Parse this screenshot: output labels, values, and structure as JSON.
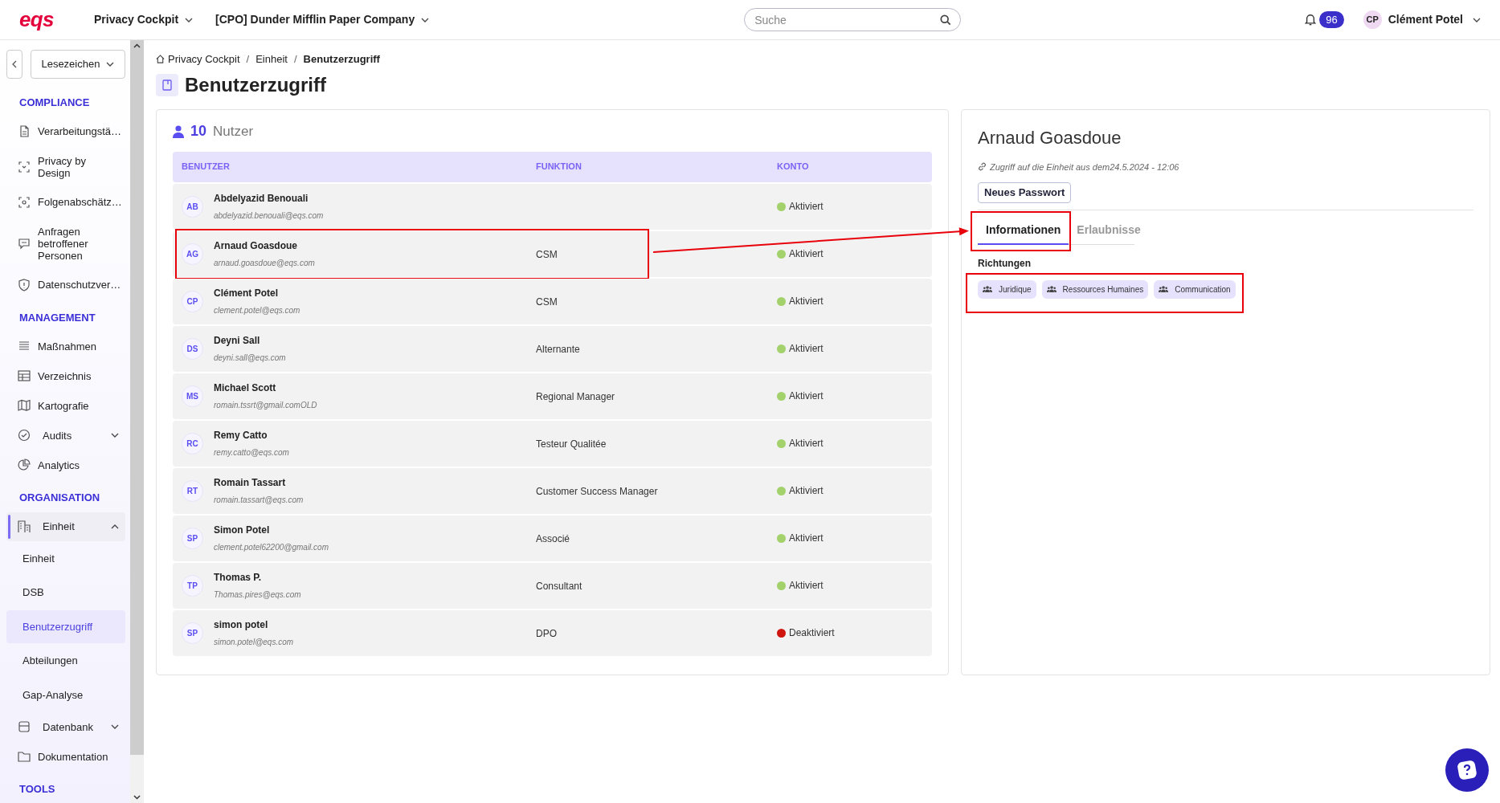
{
  "header": {
    "logo": "eqs",
    "menus": [
      "Privacy Cockpit",
      "[CPO] Dunder Mifflin Paper Company"
    ],
    "search": {
      "placeholder": "Suche"
    },
    "notifications": "96",
    "user": {
      "initials": "CP",
      "name": "Clément Potel"
    }
  },
  "sidebar": {
    "bookmarks": "Lesezeichen",
    "sections": [
      {
        "title": "COMPLIANCE",
        "items": [
          {
            "kind": "item",
            "label": "Verarbeitungstä…",
            "selected": false
          },
          {
            "kind": "item",
            "label": "Privacy by Design",
            "selected": false
          },
          {
            "kind": "item",
            "label": "Folgenabschätz…",
            "selected": false
          },
          {
            "kind": "item",
            "label": "Anfragen betroffener Personen",
            "selected": false
          },
          {
            "kind": "item",
            "label": "Datenschutzver…",
            "selected": false
          }
        ]
      },
      {
        "title": "MANAGEMENT",
        "items": [
          {
            "kind": "item",
            "label": "Maßnahmen",
            "selected": false
          },
          {
            "kind": "item",
            "label": "Verzeichnis",
            "selected": false
          },
          {
            "kind": "item",
            "label": "Kartografie",
            "selected": false
          },
          {
            "kind": "group",
            "label": "Audits",
            "expanded": false,
            "selected": false
          },
          {
            "kind": "item",
            "label": "Analytics",
            "selected": false
          }
        ]
      },
      {
        "title": "ORGANISATION",
        "items": [
          {
            "kind": "group",
            "label": "Einheit",
            "expanded": true,
            "selected": false,
            "children": [
              {
                "label": "Einheit",
                "selected": false
              },
              {
                "label": "DSB",
                "selected": false
              },
              {
                "label": "Benutzerzugriff",
                "selected": true
              },
              {
                "label": "Abteilungen",
                "selected": false
              },
              {
                "label": "Gap-Analyse",
                "selected": false
              }
            ]
          },
          {
            "kind": "group",
            "label": "Datenbank",
            "expanded": false,
            "selected": false
          },
          {
            "kind": "item",
            "label": "Dokumentation",
            "selected": false
          }
        ]
      },
      {
        "title": "TOOLS"
      }
    ]
  },
  "breadcrumb": {
    "separator": "/",
    "items": [
      "Privacy Cockpit",
      "Einheit",
      "Benutzerzugriff"
    ]
  },
  "title": "Benutzerzugriff",
  "users": {
    "count": "10",
    "count_label": "Nutzer",
    "columns": [
      "BENUTZER",
      "FUNKTION",
      "KONTO"
    ],
    "rows": [
      {
        "initials": "AB",
        "name": "Abdelyazid Benouali",
        "email": "abdelyazid.benouali@eqs.com",
        "function": "",
        "status": "Aktiviert",
        "color": "#a3d16c",
        "highlighted": false
      },
      {
        "initials": "AG",
        "name": "Arnaud Goasdoue",
        "email": "arnaud.goasdoue@eqs.com",
        "function": "CSM",
        "status": "Aktiviert",
        "color": "#a3d16c",
        "highlighted": true
      },
      {
        "initials": "CP",
        "name": "Clément Potel",
        "email": "clement.potel@eqs.com",
        "function": "CSM",
        "status": "Aktiviert",
        "color": "#a3d16c",
        "highlighted": false
      },
      {
        "initials": "DS",
        "name": "Deyni Sall",
        "email": "deyni.sall@eqs.com",
        "function": "Alternante",
        "status": "Aktiviert",
        "color": "#a3d16c",
        "highlighted": false
      },
      {
        "initials": "MS",
        "name": "Michael Scott",
        "email": "romain.tssrt@gmail.comOLD",
        "function": "Regional Manager",
        "status": "Aktiviert",
        "color": "#a3d16c",
        "highlighted": false
      },
      {
        "initials": "RC",
        "name": "Remy Catto",
        "email": "remy.catto@eqs.com",
        "function": "Testeur Qualitée",
        "status": "Aktiviert",
        "color": "#a3d16c",
        "highlighted": false
      },
      {
        "initials": "RT",
        "name": "Romain Tassart",
        "email": "romain.tassart@eqs.com",
        "function": "Customer Success Manager",
        "status": "Aktiviert",
        "color": "#a3d16c",
        "highlighted": false
      },
      {
        "initials": "SP",
        "name": "Simon Potel",
        "email": "clement.potel62200@gmail.com",
        "function": "Associé",
        "status": "Aktiviert",
        "color": "#a3d16c",
        "highlighted": false
      },
      {
        "initials": "TP",
        "name": "Thomas P.",
        "email": "Thomas.pires@eqs.com",
        "function": "Consultant",
        "status": "Aktiviert",
        "color": "#a3d16c",
        "highlighted": false
      },
      {
        "initials": "SP",
        "name": "simon potel",
        "email": "simon.potel@eqs.com",
        "function": "DPO",
        "status": "Deaktiviert",
        "color": "#d0140e",
        "highlighted": false
      }
    ]
  },
  "detail": {
    "name": "Arnaud Goasdoue",
    "access_note": "Zugriff auf die Einheit aus dem24.5.2024 - 12:06",
    "button": "Neues Passwort",
    "tabs": [
      {
        "label": "Informationen",
        "selected": true,
        "highlighted": true
      },
      {
        "label": "Erlaubnisse",
        "selected": false,
        "highlighted": false
      }
    ],
    "directions": {
      "label": "Richtungen",
      "tags": [
        "Juridique",
        "Ressources Humaines",
        "Communication"
      ],
      "highlighted": true
    }
  }
}
